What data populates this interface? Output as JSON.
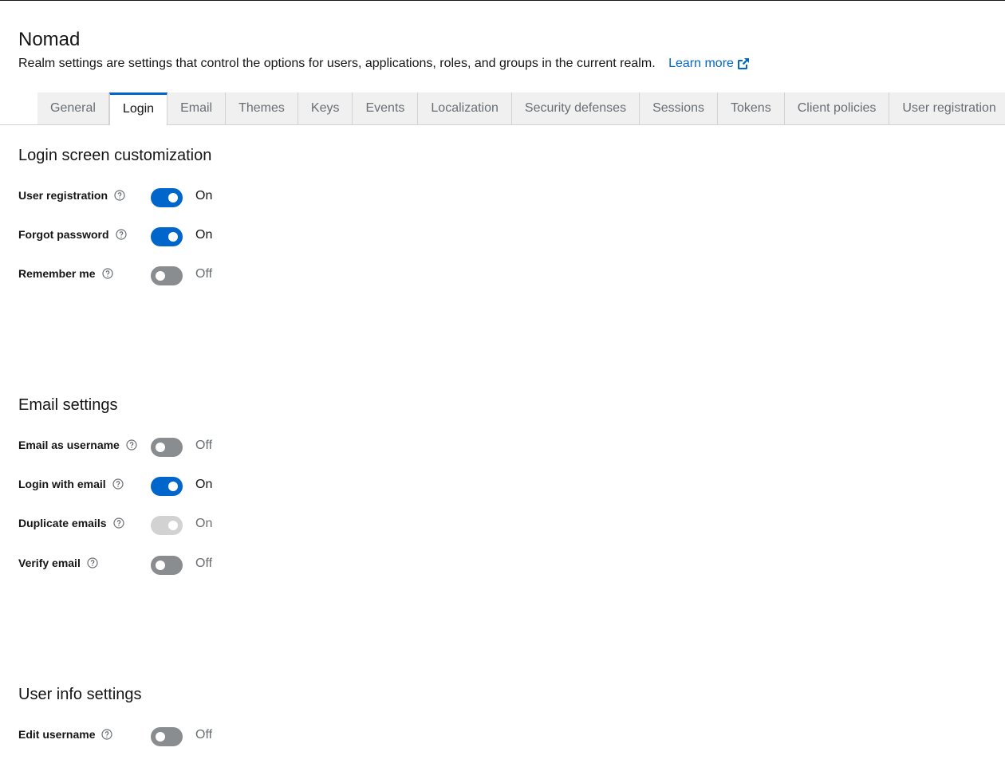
{
  "header": {
    "title": "Nomad",
    "description": "Realm settings are settings that control the options for users, applications, roles, and groups in the current realm.",
    "learn_more": "Learn more"
  },
  "tabs": [
    {
      "label": "General",
      "active": false
    },
    {
      "label": "Login",
      "active": true
    },
    {
      "label": "Email",
      "active": false
    },
    {
      "label": "Themes",
      "active": false
    },
    {
      "label": "Keys",
      "active": false
    },
    {
      "label": "Events",
      "active": false
    },
    {
      "label": "Localization",
      "active": false
    },
    {
      "label": "Security defenses",
      "active": false
    },
    {
      "label": "Sessions",
      "active": false
    },
    {
      "label": "Tokens",
      "active": false
    },
    {
      "label": "Client policies",
      "active": false
    },
    {
      "label": "User registration",
      "active": false
    }
  ],
  "sections": {
    "login_screen": {
      "title": "Login screen customization",
      "items": [
        {
          "label": "User registration",
          "state": "On",
          "checked": true,
          "disabled": false
        },
        {
          "label": "Forgot password",
          "state": "On",
          "checked": true,
          "disabled": false
        },
        {
          "label": "Remember me",
          "state": "Off",
          "checked": false,
          "disabled": false
        }
      ]
    },
    "email_settings": {
      "title": "Email settings",
      "items": [
        {
          "label": "Email as username",
          "state": "Off",
          "checked": false,
          "disabled": false
        },
        {
          "label": "Login with email",
          "state": "On",
          "checked": true,
          "disabled": false
        },
        {
          "label": "Duplicate emails",
          "state": "On",
          "checked": true,
          "disabled": true
        },
        {
          "label": "Verify email",
          "state": "Off",
          "checked": false,
          "disabled": false
        }
      ]
    },
    "user_info": {
      "title": "User info settings",
      "items": [
        {
          "label": "Edit username",
          "state": "Off",
          "checked": false,
          "disabled": false
        }
      ]
    }
  },
  "icons": {
    "help": "question-circle-icon",
    "external": "external-link-icon"
  },
  "colors": {
    "primary": "#0066cc",
    "switch_off": "#8a8d90",
    "switch_disabled": "#d2d2d2"
  }
}
